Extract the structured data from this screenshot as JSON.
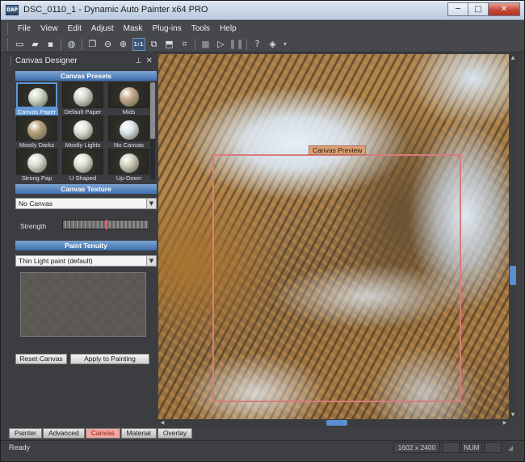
{
  "window": {
    "title": "DSC_0110_1 - Dynamic Auto Painter x64 PRO",
    "app_icon_text": "DAP",
    "minimize": "─",
    "maximize": "□",
    "close": "✕"
  },
  "menu": [
    "File",
    "View",
    "Edit",
    "Adjust",
    "Mask",
    "Plug-ins",
    "Tools",
    "Help"
  ],
  "toolbar": {
    "icons": [
      "new-document-icon",
      "open-folder-icon",
      "save-icon",
      "reset-icon",
      "photos-icon",
      "zoom-out-icon",
      "zoom-in-icon",
      "actual-size-icon",
      "fit-icon",
      "fullscreen-icon",
      "crop-icon",
      "stop-icon",
      "play-icon",
      "pause-icon",
      "help-icon",
      "paint-icon"
    ],
    "actual_size_label": "1:1",
    "more": "▾"
  },
  "panel": {
    "title": "Canvas Designer",
    "pin": "⊥",
    "close": "✕",
    "presets_header": "Canvas Presets",
    "presets": [
      {
        "label": "Canvas Paper",
        "ball": "#cfd8c8"
      },
      {
        "label": "Default Paper",
        "ball": "#d6d8cf"
      },
      {
        "label": "Mids",
        "ball": "#c7a98a"
      },
      {
        "label": "Mostly Darks",
        "ball": "#b8a27e"
      },
      {
        "label": "Mostly Lights",
        "ball": "#e0e4dc"
      },
      {
        "label": "No Canvas",
        "ball": "#dfe6ee"
      },
      {
        "label": "Strong Pap",
        "ball": "#d8ddd2"
      },
      {
        "label": "U Shaped",
        "ball": "#e2e2d8"
      },
      {
        "label": "Up-Down",
        "ball": "#d2cfbf"
      }
    ],
    "texture_header": "Canvas Texture",
    "texture_value": "No Canvas",
    "strength_label": "Strength",
    "strength_level": 0.5,
    "tenuity_header": "Paint Tenuity",
    "tenuity_value": "Thin Light paint (default)",
    "reset_button": "Reset Canvas",
    "apply_button": "Apply to Painting"
  },
  "canvas": {
    "preview_label": "Canvas Preview"
  },
  "tabs": [
    "Painter",
    "Advanced",
    "Canvas",
    "Material",
    "Overlay"
  ],
  "active_tab": "Canvas",
  "status": {
    "text": "Ready",
    "dimensions": "1602 x 2400",
    "num": "NUM"
  },
  "colors": {
    "accent": "#5f97d6",
    "preview_frame": "#d97b7f",
    "active_tab": "#f2a6a0"
  }
}
